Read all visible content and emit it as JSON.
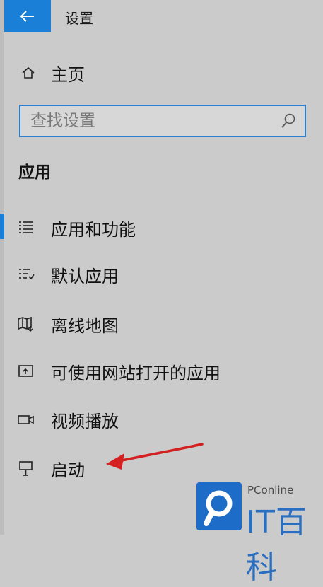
{
  "window": {
    "title": "设置"
  },
  "home": {
    "label": "主页"
  },
  "search": {
    "placeholder": "查找设置"
  },
  "section": {
    "heading": "应用"
  },
  "nav": [
    {
      "label": "应用和功能",
      "icon": "list-icon",
      "selected": true
    },
    {
      "label": "默认应用",
      "icon": "default-apps-icon",
      "selected": false
    },
    {
      "label": "离线地图",
      "icon": "offline-maps-icon",
      "selected": false
    },
    {
      "label": "可使用网站打开的应用",
      "icon": "web-apps-icon",
      "selected": false
    },
    {
      "label": "视频播放",
      "icon": "video-icon",
      "selected": false
    },
    {
      "label": "启动",
      "icon": "startup-icon",
      "selected": false
    }
  ],
  "watermark": {
    "small": "PConline",
    "main": "IT百科"
  },
  "colors": {
    "accent": "#1a7fd6",
    "arrow": "#d42020",
    "background": "#cbcbcb"
  }
}
